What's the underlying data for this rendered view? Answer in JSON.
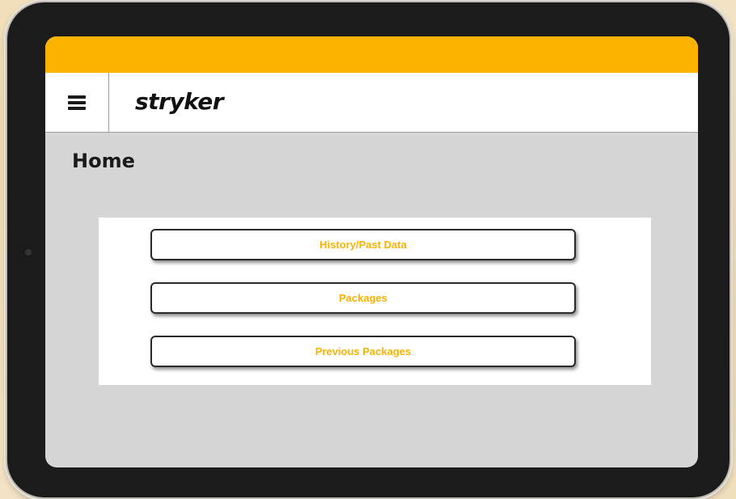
{
  "app": {
    "logo_text": "stryker",
    "brand_color": "#fbb300"
  },
  "header": {
    "menu_icon": "hamburger-menu-icon"
  },
  "page": {
    "title": "Home"
  },
  "menu": {
    "buttons": [
      {
        "label": "History/Past Data"
      },
      {
        "label": "Packages"
      },
      {
        "label": "Previous Packages"
      }
    ]
  }
}
